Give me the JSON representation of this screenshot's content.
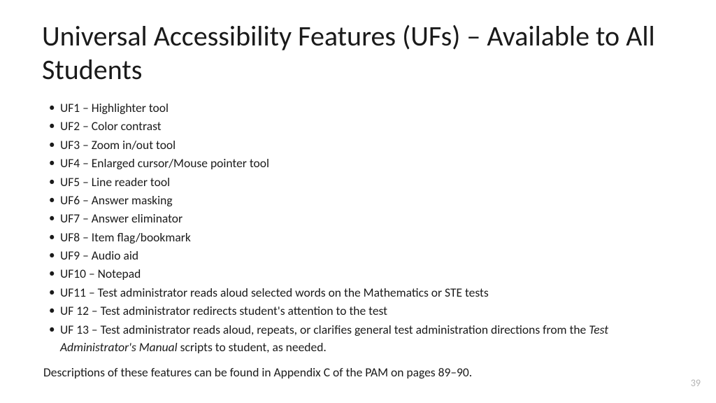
{
  "slide": {
    "title": "Universal Accessibility Features (UFs) – Available to All Students",
    "bullets": [
      "UF1 – Highlighter tool",
      "UF2 – Color contrast",
      "UF3 – Zoom in/out tool",
      "UF4 – Enlarged cursor/Mouse pointer tool",
      "UF5 – Line reader tool",
      "UF6 – Answer masking",
      "UF7 – Answer eliminator",
      "UF8 – Item flag/bookmark",
      "UF9 – Audio aid",
      "UF10 – Notepad",
      "UF11 – Test administrator reads aloud selected words on the Mathematics or STE tests",
      "UF 12 – Test administrator redirects student's attention to the test"
    ],
    "uf13_prefix": "UF 13 – Test administrator reads aloud, repeats, or clarifies general test administration directions from the ",
    "uf13_italic": "Test Administrator's Manual",
    "uf13_suffix": " scripts to student, as needed.",
    "description": "Descriptions of these features can be found in Appendix C of the PAM on pages 89–90.",
    "page_number": "39"
  }
}
